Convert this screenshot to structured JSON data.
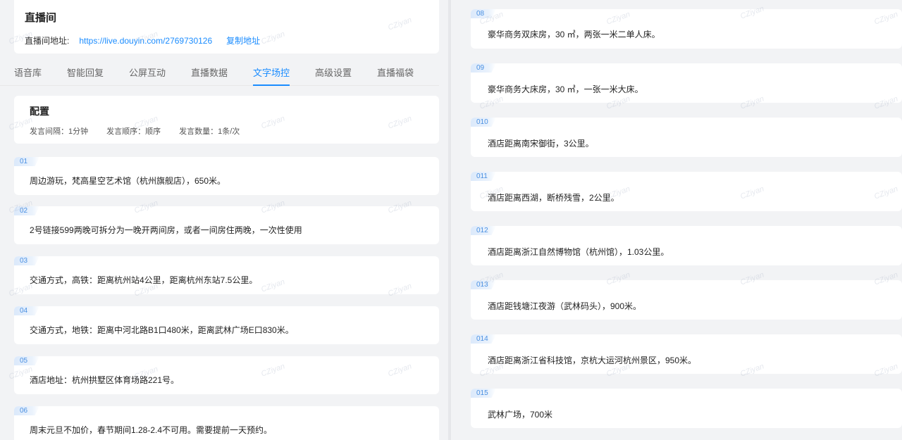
{
  "room": {
    "title": "直播间",
    "address_label": "直播间地址:",
    "url": "https://live.douyin.com/2769730126",
    "copy_label": "复制地址"
  },
  "tabs": [
    {
      "label": "语音库"
    },
    {
      "label": "智能回复"
    },
    {
      "label": "公屏互动"
    },
    {
      "label": "直播数据"
    },
    {
      "label": "文字场控"
    },
    {
      "label": "高级设置"
    },
    {
      "label": "直播福袋"
    }
  ],
  "active_tab_index": 4,
  "config": {
    "title": "配置",
    "interval": "发言间隔：1分钟",
    "order": "发言顺序：顺序",
    "count": "发言数量：1条/次"
  },
  "left_items": [
    {
      "num": "01",
      "text": "周边游玩，梵高星空艺术馆（杭州旗舰店），650米。"
    },
    {
      "num": "02",
      "text": "2号链接599两晚可拆分为一晚开两间房，或者一间房住两晚，一次性使用"
    },
    {
      "num": "03",
      "text": "交通方式，高铁：距离杭州站4公里，距离杭州东站7.5公里。"
    },
    {
      "num": "04",
      "text": "交通方式，地铁：距离中河北路B1口480米，距离武林广场E口830米。"
    },
    {
      "num": "05",
      "text": "酒店地址：杭州拱墅区体育场路221号。"
    },
    {
      "num": "06",
      "text": "周末元旦不加价，春节期间1.28-2.4不可用。需要提前一天预约。"
    }
  ],
  "right_items": [
    {
      "num": "08",
      "text": "豪华商务双床房，30 ㎡，两张一米二单人床。"
    },
    {
      "num": "09",
      "text": "豪华商务大床房，30 ㎡，一张一米大床。"
    },
    {
      "num": "010",
      "text": "酒店距离南宋御街，3公里。"
    },
    {
      "num": "011",
      "text": "酒店距离西湖，断桥残雪，2公里。"
    },
    {
      "num": "012",
      "text": "酒店距离浙江自然博物馆（杭州馆），1.03公里。"
    },
    {
      "num": "013",
      "text": "酒店距钱塘江夜游（武林码头），900米。"
    },
    {
      "num": "014",
      "text": "酒店距离浙江省科技馆，京杭大运河杭州景区，950米。"
    },
    {
      "num": "015",
      "text": "武林广场，700米"
    }
  ],
  "watermark": "CZiyan",
  "colors": {
    "accent": "#1a8cff",
    "background": "#f2f3f5",
    "card": "#ffffff"
  }
}
